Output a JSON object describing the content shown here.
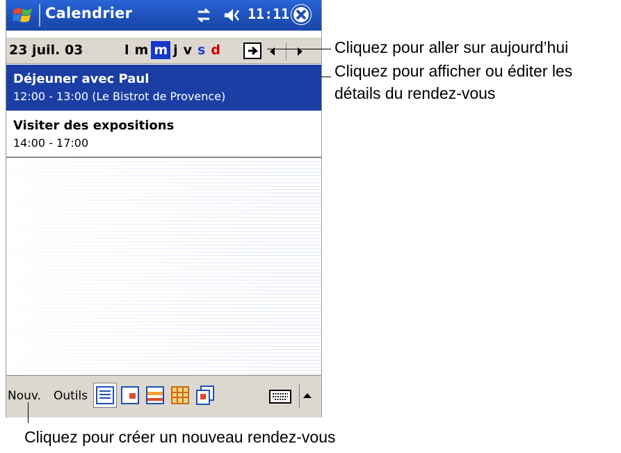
{
  "titlebar": {
    "title": "Calendrier",
    "time": "11:11",
    "icons": [
      "windows-start-icon",
      "connectivity-icon",
      "volume-icon",
      "close-icon"
    ]
  },
  "datebar": {
    "date": "23 juil. 03",
    "days": [
      {
        "label": "l",
        "kind": "normal"
      },
      {
        "label": "m",
        "kind": "normal"
      },
      {
        "label": "m",
        "kind": "selected"
      },
      {
        "label": "j",
        "kind": "normal"
      },
      {
        "label": "v",
        "kind": "normal"
      },
      {
        "label": "s",
        "kind": "sat"
      },
      {
        "label": "d",
        "kind": "sun"
      }
    ],
    "icons": [
      "goto-today-icon",
      "arrow-left-icon",
      "arrow-right-icon"
    ]
  },
  "appointments": [
    {
      "title": "Déjeuner avec Paul",
      "time": "12:00 - 13:00  (Le Bistrot de Provence)",
      "selected": true
    },
    {
      "title": "Visiter des expositions",
      "time": "14:00 - 17:00",
      "selected": false
    }
  ],
  "cmdbar": {
    "new_label": "Nouv.",
    "tools_label": "Outils",
    "views": [
      "agenda-view-icon",
      "day-view-icon",
      "week-view-icon",
      "month-view-icon",
      "year-view-icon"
    ],
    "icons": [
      "keyboard-icon",
      "arrow-up-icon"
    ]
  },
  "callouts": {
    "today": "Cliquez pour aller  sur aujourd’hui",
    "details_line1": "Cliquez pour afficher ou éditer les",
    "details_line2": "détails du rendez-vous",
    "new": "Cliquez pour créer un nouveau rendez-vous"
  },
  "colors": {
    "titlebar": "#1d4fb7",
    "selected_row": "#1b3ea5",
    "selected_day": "#1637c7",
    "saturday": "#1e3fd1",
    "sunday": "#d00000"
  }
}
